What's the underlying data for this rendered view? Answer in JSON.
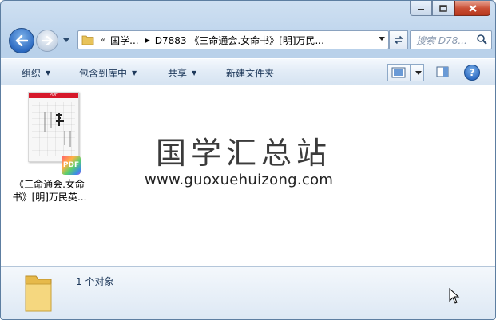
{
  "window": {
    "caption_buttons": [
      "minimize",
      "maximize",
      "close"
    ]
  },
  "nav": {
    "back_icon": "back-arrow-icon",
    "forward_icon": "forward-arrow-icon",
    "breadcrumb_overflow": "«",
    "breadcrumbs": [
      "国学...",
      "D7883 《三命通会.女命书》[明]万民..."
    ],
    "search_placeholder": "搜索 D78..."
  },
  "toolbar": {
    "organize": "组织",
    "include_in_library": "包含到库中",
    "share": "共享",
    "new_folder": "新建文件夹"
  },
  "files": [
    {
      "name_line1": "《三命通会.女命",
      "name_line2": "书》[明]万民英...",
      "type_badge": "PDF",
      "thumb_header": "PDF"
    }
  ],
  "watermark": {
    "title": "国学汇总站",
    "url": "www.guoxuehuizong.com"
  },
  "details": {
    "count_text": "1 个对象"
  },
  "colors": {
    "accent_blue": "#2d6bc2",
    "close_red": "#c94d33",
    "pdf_header_red": "#d6182a"
  }
}
